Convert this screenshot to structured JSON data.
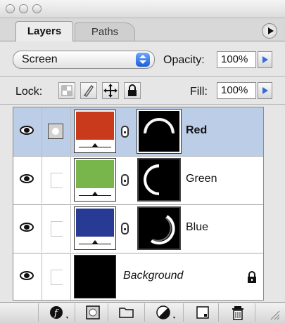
{
  "tabs": [
    {
      "label": "Layers",
      "active": true
    },
    {
      "label": "Paths",
      "active": false
    }
  ],
  "blend_mode": {
    "value": "Screen"
  },
  "opacity": {
    "label": "Opacity:",
    "value": "100%"
  },
  "lock": {
    "label": "Lock:"
  },
  "fill": {
    "label": "Fill:",
    "value": "100%"
  },
  "layers": [
    {
      "name": "Red",
      "color": "#c9391b",
      "selected": true
    },
    {
      "name": "Green",
      "color": "#78b54a",
      "selected": false
    },
    {
      "name": "Blue",
      "color": "#283b94",
      "selected": false
    },
    {
      "name": "Background",
      "color": "#000000",
      "locked": true
    }
  ],
  "colors": {
    "selection": "#bccde8",
    "accent": "#2f6ed8"
  },
  "icons": [
    "eye-icon",
    "layer-mask-icon",
    "link-chain-icon",
    "lock-icon",
    "transparency-lock-icon",
    "brush-lock-icon",
    "move-lock-icon",
    "all-lock-icon",
    "panel-menu-icon",
    "layer-style-icon",
    "add-mask-icon",
    "new-group-icon",
    "adjustment-layer-icon",
    "new-layer-icon",
    "trash-icon",
    "resize-grip-icon"
  ]
}
